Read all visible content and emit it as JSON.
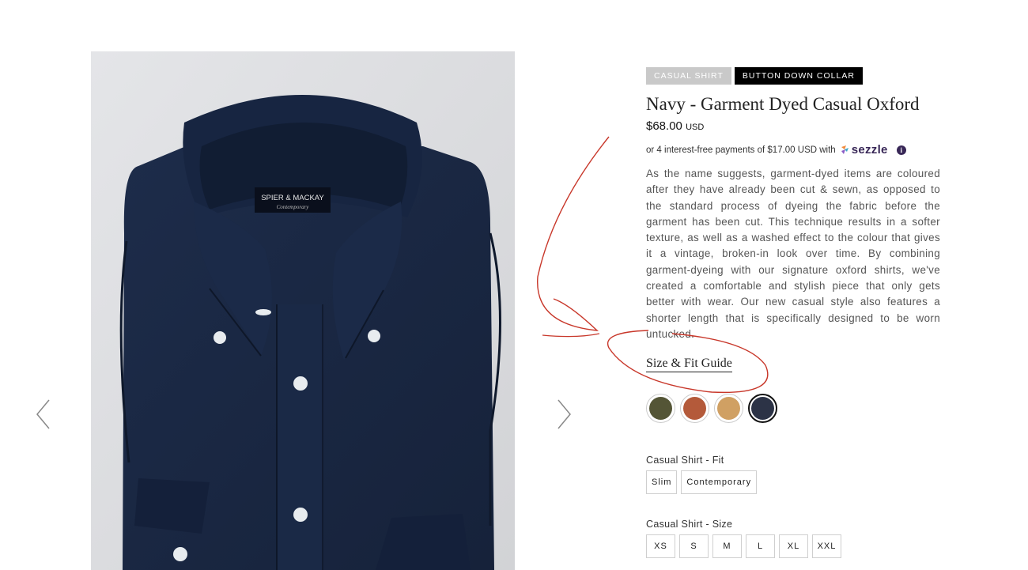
{
  "product": {
    "tags": [
      "CASUAL SHIRT",
      "BUTTON DOWN COLLAR"
    ],
    "title": "Navy - Garment Dyed Casual Oxford",
    "price": "$68.00",
    "currency": "USD",
    "installments": "or 4 interest-free payments of $17.00 USD with",
    "sezzle_label": "sezzle",
    "info_glyph": "i",
    "description": "As the name suggests, garment-dyed items are coloured after they have already been cut & sewn, as opposed to the standard process of dyeing the fabric before the garment has been cut. This technique results in a softer texture, as well as a washed effect to the colour that gives it a vintage, broken-in look over time. By combining garment-dyeing with our signature oxford shirts, we've created a comfortable and stylish piece that only gets better with wear. Our new casual style also features a shorter length that is specifically designed to be worn untucked.",
    "size_guide_label": "Size & Fit Guide"
  },
  "image": {
    "label_brand": "SPIER & MACKAY",
    "label_line": "Contemporary"
  },
  "swatches": [
    {
      "name": "olive",
      "color": "#545536"
    },
    {
      "name": "rust",
      "color": "#b45a3a"
    },
    {
      "name": "tan",
      "color": "#d0a063"
    },
    {
      "name": "navy",
      "color": "#2c3346",
      "selected": true
    }
  ],
  "fit": {
    "label": "Casual Shirt - Fit",
    "options": [
      "Slim",
      "Contemporary"
    ]
  },
  "size": {
    "label": "Casual Shirt - Size",
    "options": [
      "XS",
      "S",
      "M",
      "L",
      "XL",
      "XXL"
    ]
  },
  "colors": {
    "annotation": "#c8372a",
    "sezzle": "#382757"
  }
}
